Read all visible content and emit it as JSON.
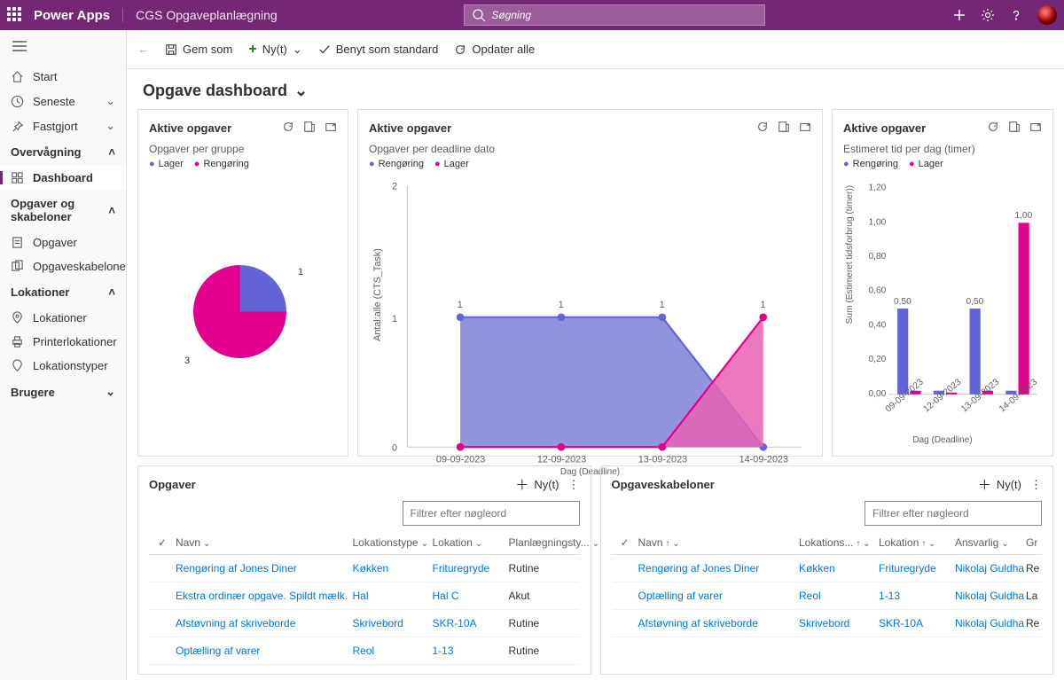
{
  "header": {
    "brand": "Power Apps",
    "appname": "CGS Opgaveplanlægning",
    "search_placeholder": "Søgning"
  },
  "sidebar": {
    "start": "Start",
    "recent": "Seneste",
    "pinned": "Fastgjort",
    "group_monitor": "Overvågning",
    "dashboard": "Dashboard",
    "group_tasks": "Opgaver og skabeloner",
    "tasks": "Opgaver",
    "templates": "Opgaveskabeloner",
    "group_loc": "Lokationer",
    "locations": "Lokationer",
    "printerloc": "Printerlokationer",
    "loctypes": "Lokationstyper",
    "group_users": "Brugere"
  },
  "cmdbar": {
    "save_as": "Gem som",
    "new": "Ny(t)",
    "use_default": "Benyt som standard",
    "refresh_all": "Opdater alle"
  },
  "page_title": "Opgave dashboard",
  "cards": {
    "pie": {
      "title": "Aktive opgaver",
      "subtitle": "Opgaver per gruppe",
      "legend": [
        "Lager",
        "Rengøring"
      ],
      "label1": "1",
      "label3": "3"
    },
    "area": {
      "title": "Aktive opgaver",
      "subtitle": "Opgaver per deadline dato",
      "legend": [
        "Rengøring",
        "Lager"
      ],
      "ylabel": "Antal:alle (CTS_Task)",
      "xlabel": "Dag (Deadline)"
    },
    "bar": {
      "title": "Aktive opgaver",
      "subtitle": "Estimeret tid per dag (timer)",
      "legend": [
        "Rengøring",
        "Lager"
      ],
      "ylabel": "Sum (Estimeret tidsforbrug (timer))",
      "xlabel": "Dag (Deadline)"
    }
  },
  "chart_data": [
    {
      "type": "pie",
      "title": "Opgaver per gruppe",
      "series": [
        {
          "name": "Lager",
          "value": 1
        },
        {
          "name": "Rengøring",
          "value": 3
        }
      ]
    },
    {
      "type": "area",
      "title": "Opgaver per deadline dato",
      "xlabel": "Dag (Deadline)",
      "ylabel": "Antal:alle (CTS_Task)",
      "ylim": [
        0,
        2
      ],
      "categories": [
        "09-09-2023",
        "12-09-2023",
        "13-09-2023",
        "14-09-2023"
      ],
      "series": [
        {
          "name": "Rengøring",
          "values": [
            1,
            1,
            1,
            0
          ]
        },
        {
          "name": "Lager",
          "values": [
            0,
            0,
            0,
            1
          ]
        }
      ]
    },
    {
      "type": "bar",
      "title": "Estimeret tid per dag (timer)",
      "xlabel": "Dag (Deadline)",
      "ylabel": "Sum (Estimeret tidsforbrug (timer))",
      "ylim": [
        0,
        1.2
      ],
      "categories": [
        "09-09-2023",
        "12-09-2023",
        "13-09-2023",
        "14-09-2023"
      ],
      "series": [
        {
          "name": "Rengøring",
          "values": [
            0.5,
            0.02,
            0.5,
            0.02
          ]
        },
        {
          "name": "Lager",
          "values": [
            0.0,
            0.0,
            0.0,
            1.0
          ]
        }
      ],
      "data_labels": [
        "0,50",
        "",
        "0,50",
        "1,00"
      ]
    }
  ],
  "tasks_panel": {
    "title": "Opgaver",
    "new": "Ny(t)",
    "filter_placeholder": "Filtrer efter nøgleord",
    "cols": {
      "name": "Navn",
      "loctype": "Lokationstype",
      "location": "Lokation",
      "plan": "Planlægningsty..."
    },
    "rows": [
      {
        "name": "Rengøring af Jones Diner",
        "loctype": "Køkken",
        "location": "Frituregryde",
        "plan": "Rutine"
      },
      {
        "name": "Ekstra ordinær opgave. Spildt mælk.",
        "loctype": "Hal",
        "location": "Hal C",
        "plan": "Akut"
      },
      {
        "name": "Afstøvning af skriveborde",
        "loctype": "Skrivebord",
        "location": "SKR-10A",
        "plan": "Rutine"
      },
      {
        "name": "Optælling af varer",
        "loctype": "Reol",
        "location": "1-13",
        "plan": "Rutine"
      }
    ]
  },
  "templates_panel": {
    "title": "Opgaveskabeloner",
    "new": "Ny(t)",
    "filter_placeholder": "Filtrer efter nøgleord",
    "cols": {
      "name": "Navn",
      "loctype": "Lokations...",
      "location": "Lokation",
      "ansv": "Ansvarlig",
      "gr": "Gr"
    },
    "rows": [
      {
        "name": "Rengøring af Jones Diner",
        "loctype": "Køkken",
        "location": "Frituregryde",
        "ansv": "Nikolaj Guldha",
        "gr": "Re"
      },
      {
        "name": "Optælling af varer",
        "loctype": "Reol",
        "location": "1-13",
        "ansv": "Nikolaj Guldha",
        "gr": "La"
      },
      {
        "name": "Afstøvning af skriveborde",
        "loctype": "Skrivebord",
        "location": "SKR-10A",
        "ansv": "Nikolaj Guldha",
        "gr": "Re"
      }
    ]
  }
}
